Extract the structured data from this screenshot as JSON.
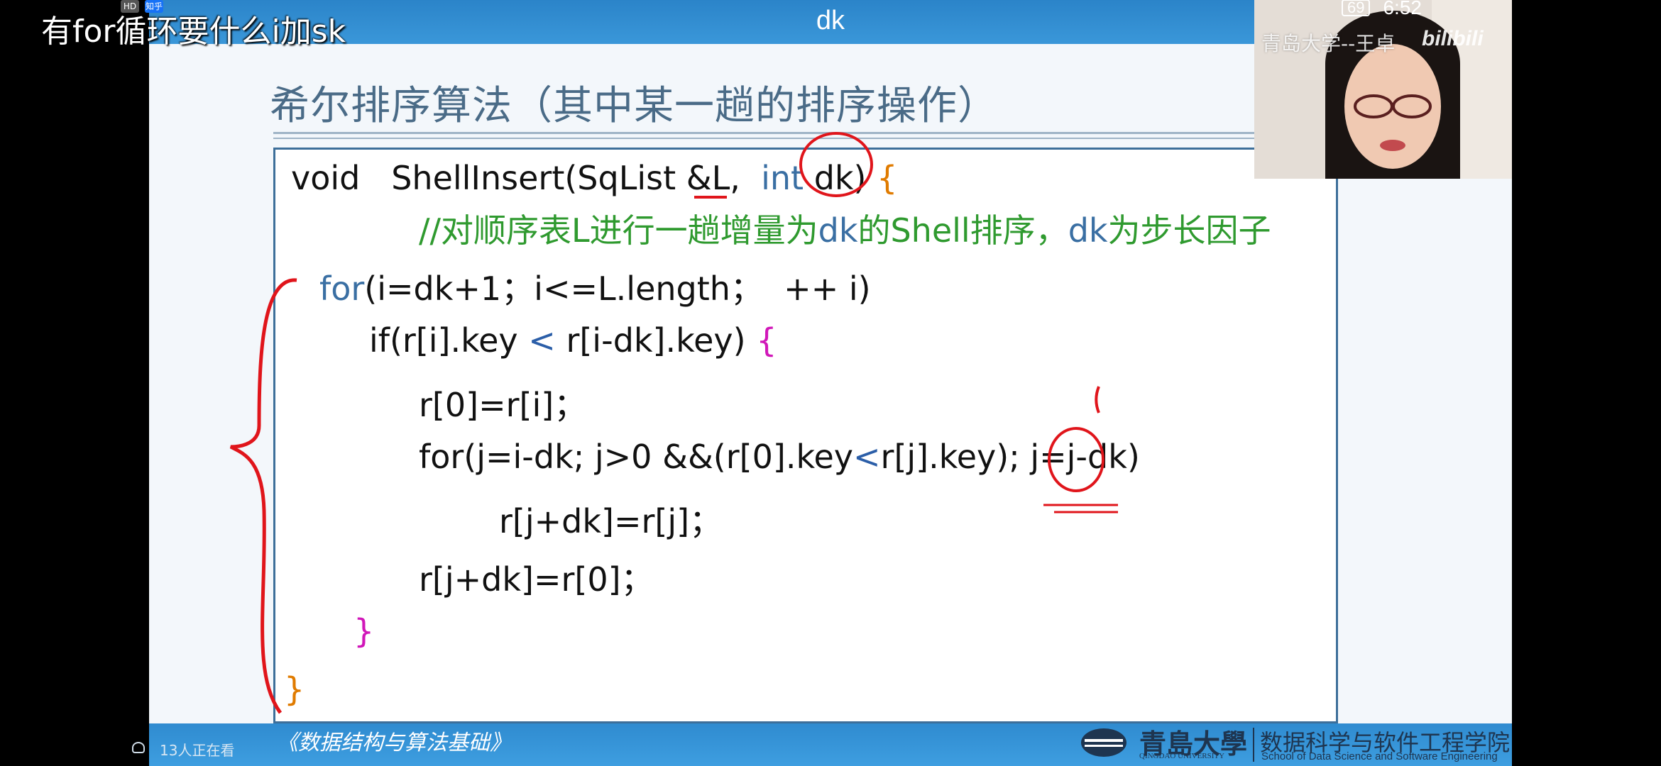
{
  "overlay": {
    "danmaku_text": "有for循环要什么i加sk",
    "status_time": "6:52",
    "battery_level": "69",
    "mini_icons": [
      "HD",
      "知乎"
    ]
  },
  "slide": {
    "topbar_title": "dk",
    "title": "希尔排序算法（其中某一趟的排序操作）",
    "code": [
      {
        "parts": [
          [
            "n",
            "void   ShellInsert(SqList &L,  "
          ],
          [
            "kw",
            "int"
          ],
          [
            "n",
            " dk) "
          ],
          [
            "o",
            "{"
          ]
        ]
      },
      {
        "parts": [
          [
            "cmt",
            "//对顺序表L进行一趟增量为"
          ],
          [
            "kw",
            "dk"
          ],
          [
            "cmt",
            "的Shell排序，"
          ],
          [
            "kw",
            "dk"
          ],
          [
            "cmt",
            "为步长因子"
          ]
        ]
      },
      {
        "parts": [
          [
            "kw",
            "for"
          ],
          [
            "n",
            "(i=dk+1；i<=L.length；  ++ i)"
          ]
        ]
      },
      {
        "parts": [
          [
            "n",
            "if(r[i].key "
          ],
          [
            "b",
            "<"
          ],
          [
            "n",
            " r[i-dk].key) "
          ],
          [
            "m",
            "{"
          ]
        ]
      },
      {
        "parts": [
          [
            "n",
            "r[0]=r[i]；"
          ]
        ]
      },
      {
        "parts": [
          [
            "n",
            "for(j=i-dk; j>0 &&(r[0].key"
          ],
          [
            "b",
            "<"
          ],
          [
            "n",
            "r[j].key); j=j-dk)"
          ]
        ]
      },
      {
        "parts": [
          [
            "n",
            "r[j+dk]=r[j]；"
          ]
        ]
      },
      {
        "parts": [
          [
            "n",
            "r[j+dk]=r[0]；"
          ]
        ]
      },
      {
        "parts": [
          [
            "m",
            "}"
          ]
        ]
      },
      {
        "parts": [
          [
            "o",
            "}"
          ]
        ]
      }
    ],
    "course_name": "《数据结构与算法基础》",
    "university_name": "青島大學",
    "university_en": "QINGDAO UNIVERSITY",
    "department_zh": "数据科学与软件工程学院",
    "department_en": "School of Data Science and Software Engineering",
    "viewer_count": "13人正在看"
  },
  "webcam": {
    "label": "青岛大学--王卓",
    "logo": "bilibili"
  },
  "colors": {
    "keyword": "#3a6fa3",
    "comment": "#2f9a2f",
    "outer_brace": "#e07b00",
    "inner_brace": "#d117b9",
    "annotation_red": "#e0151b"
  }
}
